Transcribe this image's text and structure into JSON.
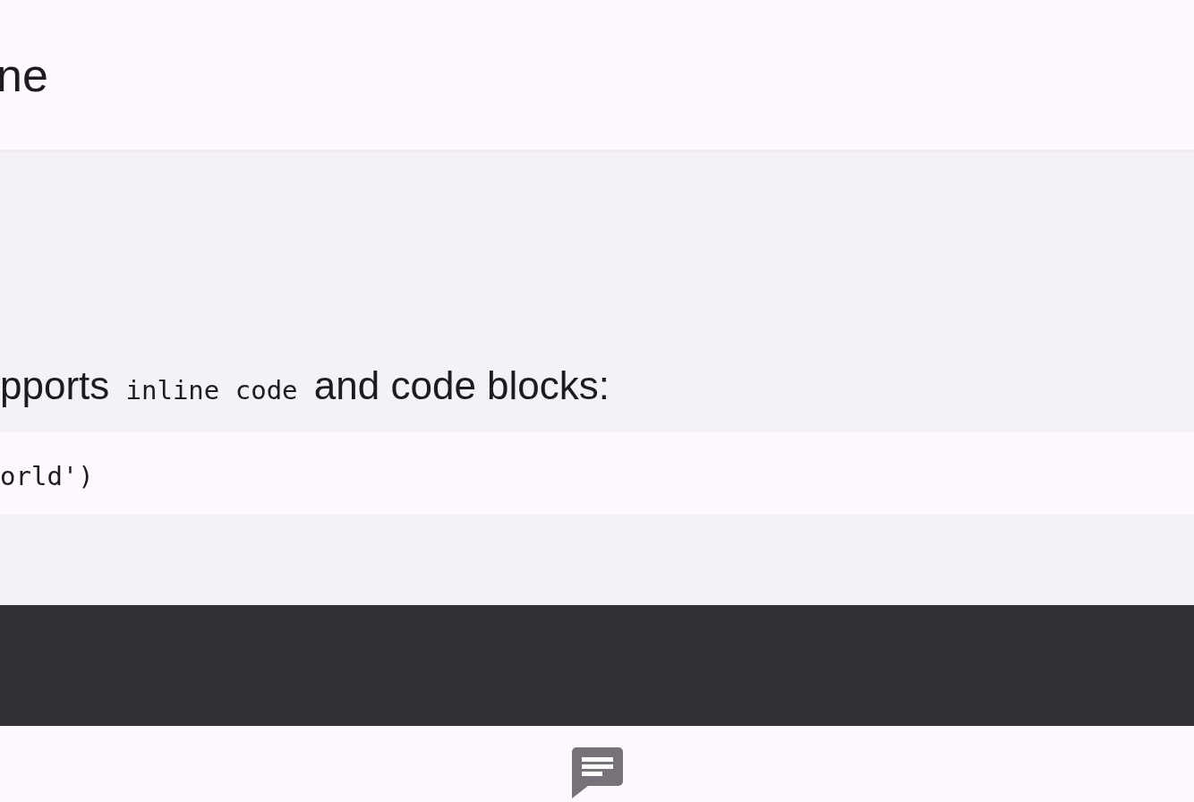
{
  "header": {
    "title": "ne"
  },
  "message": {
    "paragraph": [
      {
        "kind": "text",
        "text": "pports "
      },
      {
        "kind": "code",
        "text": "inline code"
      },
      {
        "kind": "text",
        "text": " and code blocks:"
      }
    ],
    "code_block": "orld')"
  }
}
